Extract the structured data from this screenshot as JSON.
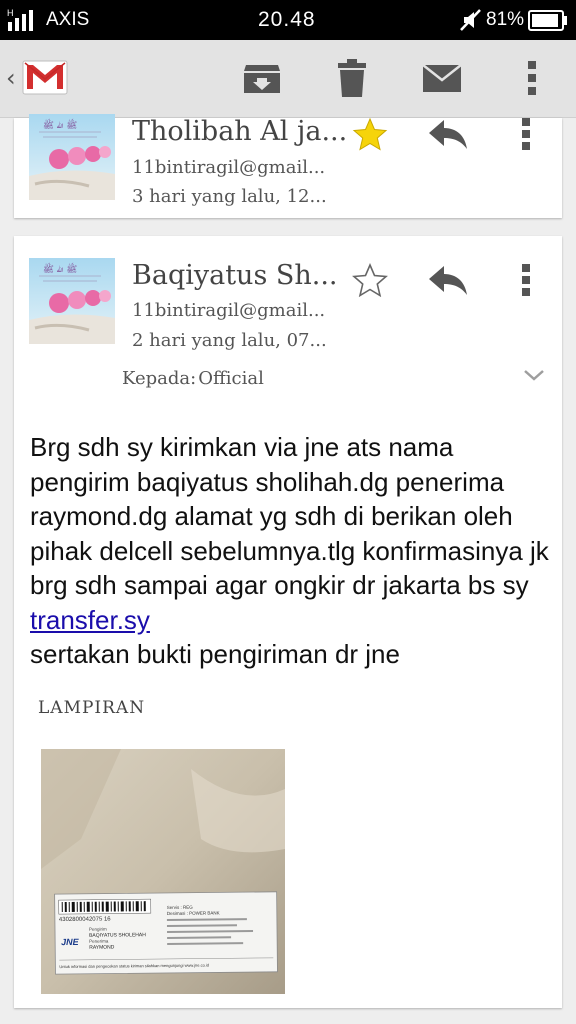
{
  "status_bar": {
    "network_type": "H",
    "carrier": "AXIS",
    "time": "20.48",
    "battery": "81%"
  },
  "action_bar": {
    "back_icon": "chevron-left-icon",
    "app_icon": "gmail-logo",
    "actions": [
      "archive-icon",
      "delete-icon",
      "mark-unread-icon",
      "overflow-menu-icon"
    ]
  },
  "messages": [
    {
      "sender": "Tholibah Al ja...",
      "email": "11bintiragil@gmail...",
      "time": "3 hari yang lalu, 12...",
      "starred": true
    },
    {
      "sender": "Baqiyatus Sh...",
      "email": "11bintiragil@gmail...",
      "time": "2 hari yang lalu, 07...",
      "starred": false,
      "recipient_label": "Kepada:",
      "recipient_name": "Official",
      "body_text": "Brg sdh sy kirimkan via jne ats nama pengirim baqiyatus sholihah.dg penerima raymond.dg alamat yg sdh di berikan oleh pihak delcell sebelumnya.tlg konfirmasinya jk brg sdh sampai agar ongkir dr jakarta bs sy ",
      "body_link": "transfer.sy",
      "body_text_end": "sertakan bukti pengiriman dr jne",
      "attachments_title": "LAMPIRAN",
      "attachment": {
        "barcode_number": "4302800042075 16",
        "logo": "JNE",
        "sender_label": "Pengirim",
        "sender_value": "BAQIYATUS SHOLEHAH",
        "receiver_label": "Penerima",
        "receiver_value": "RAYMOND",
        "service": "Servis : REG",
        "contents": "Desimasi : POWER BANK",
        "footer": "Untuk informasi dan pengecekan status kiriman silahkan mengunjungi www.jne.co.id"
      }
    }
  ],
  "colors": {
    "status_bar": "#000000",
    "action_bar": "#e3e3e3",
    "background": "#eeeeee",
    "star_filled": "#f6d40a",
    "link": "#1a0dab",
    "icon_gray": "#555555"
  }
}
